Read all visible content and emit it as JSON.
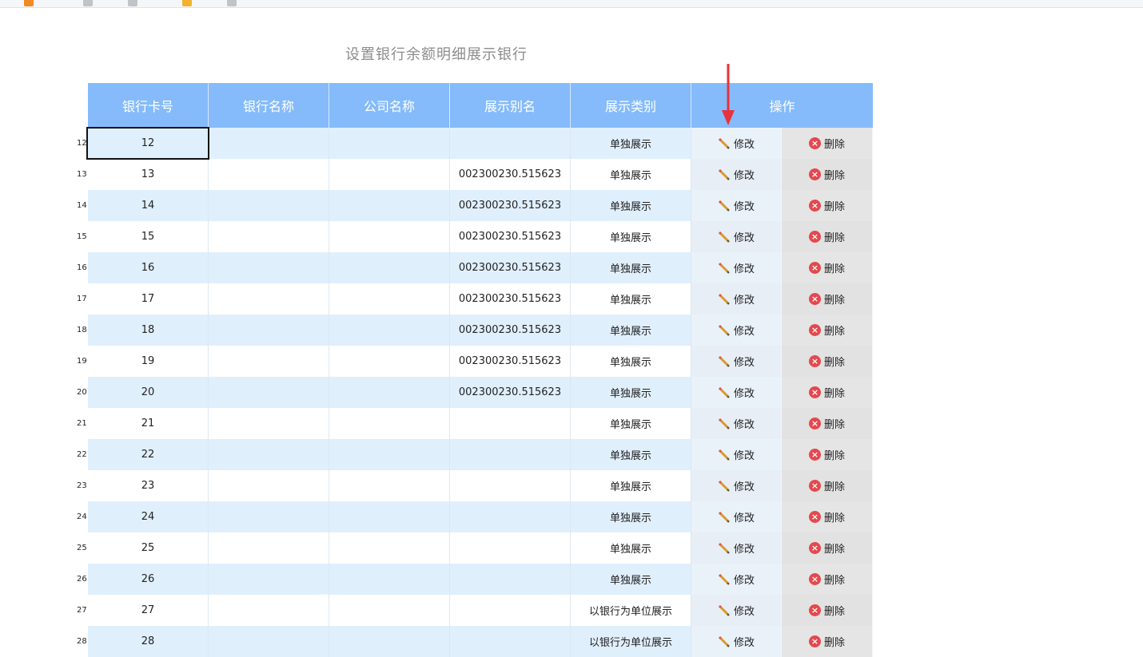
{
  "page_title": "设置银行余额明细展示银行",
  "columns": [
    "银行卡号",
    "银行名称",
    "公司名称",
    "展示别名",
    "展示类别",
    "操作"
  ],
  "actions": {
    "edit_label": "修改",
    "delete_label": "删除"
  },
  "rows": [
    {
      "num": "12",
      "card": "12",
      "bank": "",
      "company": "",
      "alias": "",
      "type": "单独展示"
    },
    {
      "num": "13",
      "card": "13",
      "bank": "",
      "company": "",
      "alias": "002300230.515623",
      "type": "单独展示"
    },
    {
      "num": "14",
      "card": "14",
      "bank": "",
      "company": "",
      "alias": "002300230.515623",
      "type": "单独展示"
    },
    {
      "num": "15",
      "card": "15",
      "bank": "",
      "company": "",
      "alias": "002300230.515623",
      "type": "单独展示"
    },
    {
      "num": "16",
      "card": "16",
      "bank": "",
      "company": "",
      "alias": "002300230.515623",
      "type": "单独展示"
    },
    {
      "num": "17",
      "card": "17",
      "bank": "",
      "company": "",
      "alias": "002300230.515623",
      "type": "单独展示"
    },
    {
      "num": "18",
      "card": "18",
      "bank": "",
      "company": "",
      "alias": "002300230.515623",
      "type": "单独展示"
    },
    {
      "num": "19",
      "card": "19",
      "bank": "",
      "company": "",
      "alias": "002300230.515623",
      "type": "单独展示"
    },
    {
      "num": "20",
      "card": "20",
      "bank": "",
      "company": "",
      "alias": "002300230.515623",
      "type": "单独展示"
    },
    {
      "num": "21",
      "card": "21",
      "bank": "",
      "company": "",
      "alias": "",
      "type": "单独展示"
    },
    {
      "num": "22",
      "card": "22",
      "bank": "",
      "company": "",
      "alias": "",
      "type": "单独展示"
    },
    {
      "num": "23",
      "card": "23",
      "bank": "",
      "company": "",
      "alias": "",
      "type": "单独展示"
    },
    {
      "num": "24",
      "card": "24",
      "bank": "",
      "company": "",
      "alias": "",
      "type": "单独展示"
    },
    {
      "num": "25",
      "card": "25",
      "bank": "",
      "company": "",
      "alias": "",
      "type": "单独展示"
    },
    {
      "num": "26",
      "card": "26",
      "bank": "",
      "company": "",
      "alias": "",
      "type": "单独展示"
    },
    {
      "num": "27",
      "card": "27",
      "bank": "",
      "company": "",
      "alias": "",
      "type": "以银行为单位展示"
    },
    {
      "num": "28",
      "card": "28",
      "bank": "",
      "company": "",
      "alias": "",
      "type": "以银行为单位展示"
    }
  ],
  "colors": {
    "header_bg": "#85bbfa",
    "row_alt_bg": "#e0effc",
    "arrow": "#e8323c",
    "delete_icon": "#e5484d"
  }
}
